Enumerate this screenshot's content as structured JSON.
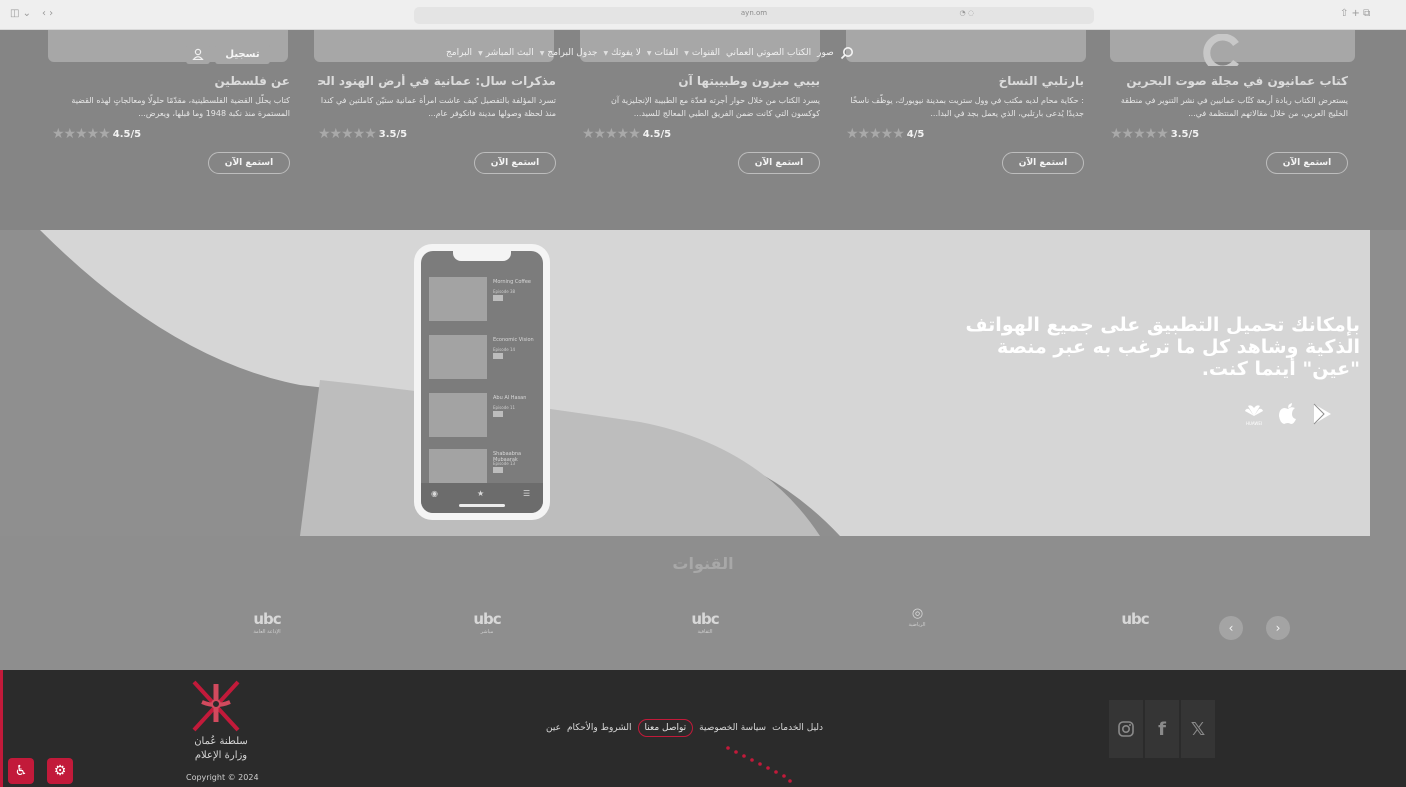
{
  "browser": {
    "url": "ayn.om",
    "controls": [
      "◫ ⌄",
      "‹ ›"
    ],
    "right_controls": "⇧  +  ⧉"
  },
  "header": {
    "nav": [
      {
        "label": "البرامج",
        "caret": false
      },
      {
        "label": "البث المباشر",
        "caret": true
      },
      {
        "label": "جدول البرامج",
        "caret": true
      },
      {
        "label": "لا يفوتك",
        "caret": true
      },
      {
        "label": "الفئات",
        "caret": true
      },
      {
        "label": "القنوات",
        "caret": true
      },
      {
        "label": "الكتاب الصوتي العماني",
        "caret": false
      },
      {
        "label": "صور",
        "caret": false
      }
    ],
    "register_label": "تسجيل",
    "search_icon": "search-icon",
    "user_icon": "user-icon"
  },
  "cards": [
    {
      "title": "كتاب عمانيون في مجلة صوت البحرين",
      "desc": "يستعرض الكتاب ريادة أربعة كتّاب عمانيين في نشر التنوير في منطقة الخليج العربي، من خلال مقالاتهم المنتظمة في...",
      "stars": "★★★★★",
      "score": "3.5/5",
      "button": "استمع الآن"
    },
    {
      "title": "بارتلبي النساخ",
      "desc": ": حكاية محام لديه مكتب في وول ستريت بمدينة نيويورك، يوظّف ناسخًا جديدًا يُدعى بارتلبي، الذي يعمل بجد في البدا...",
      "stars": "★★★★★",
      "score": "4/5",
      "button": "استمع الآن"
    },
    {
      "title": "بيبي ميزون وطبيبتها آن",
      "desc": "يسرد الكتاب من خلال حوار أجرته قعدّة مع الطبيبة الإنجليزية آن كوكسون التي كانت ضمن الفريق الطبي المعالج للسيد...",
      "stars": "★★★★★",
      "score": "4.5/5",
      "button": "استمع الآن"
    },
    {
      "title": "مذكرات سال: عمانية في أرض الهنود الحمر",
      "desc": "تسرد المؤلفة بالتفصيل كيف عاشت امرأة عمانية ستيّن كاملتين في كندا منذ لحظة وصولها مدينة فانكوفر عام...",
      "stars": "★★★★★",
      "score": "3.5/5",
      "button": "استمع الآن"
    },
    {
      "title": "عن فلسطين",
      "desc": "كتاب يحلّل القضية الفلسطينية، مقدّمًا حلولًا ومعالجاتٍ لهذه القضية المستمرة منذ نكبة 1948 وما قبلها، ويعرض...",
      "stars": "★★★★★",
      "score": "4.5/5",
      "button": "استمع الآن"
    }
  ],
  "promo": {
    "line1": "بإمكانك تحميل التطبيق على جميع الهواتف",
    "line2": "الذكية وشاهد كل ما ترغب به عبر منصة",
    "line3": "\"عين\" أينما كنت.",
    "stores": [
      "huawei-icon",
      "apple-icon",
      "google-play-icon"
    ],
    "huawei_label": "HUAWEI",
    "phone_rows": [
      {
        "title": "Morning Coffee",
        "episode": "Episode 38"
      },
      {
        "title": "Economic Vision",
        "episode": "Episode 14"
      },
      {
        "title": "Abu Al Hasan",
        "episode": "Episode 11"
      },
      {
        "title": "Shabaabna Mubaarak",
        "episode": "Episode 13"
      }
    ]
  },
  "channels": {
    "title": "القنوات",
    "logos": [
      {
        "mark": "ubc",
        "sub": ""
      },
      {
        "mark": "◎",
        "sub": "الرياضية"
      },
      {
        "mark": "ubc",
        "sub": "الثقافية"
      },
      {
        "mark": "ubc",
        "sub": "مباشر"
      },
      {
        "mark": "ubc",
        "sub": "الإذاعة العامة"
      }
    ],
    "prev": "‹",
    "next": "›"
  },
  "footer": {
    "links": [
      "عين",
      "الشروط والأحكام",
      "تواصل معنا",
      "سياسة الخصوصية",
      "دليل الخدمات"
    ],
    "highlighted_link": "تواصل معنا",
    "gov_line1": "سلطنة عُمان",
    "gov_line2": "وزارة الإعلام",
    "copyright": "Copyright © 2024",
    "social": [
      "instagram-icon",
      "facebook-icon",
      "x-icon"
    ],
    "accent_color": "#c21a3a"
  }
}
